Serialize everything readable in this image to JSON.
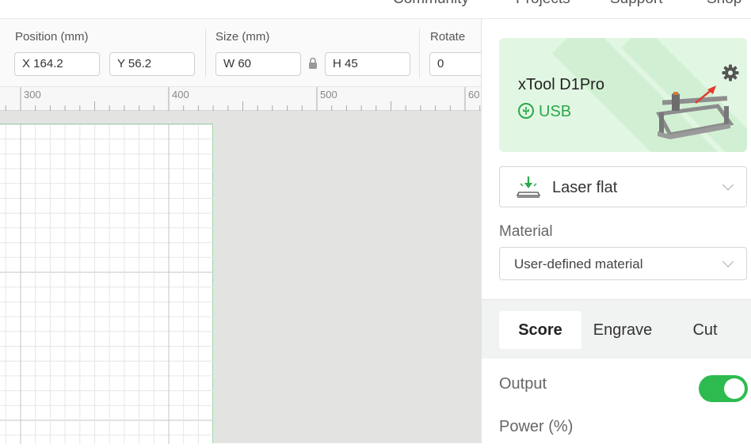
{
  "nav": {
    "links": [
      "Community",
      "Projects",
      "Support",
      "Shop"
    ]
  },
  "toolbar": {
    "position": {
      "label": "Position (mm)",
      "x": "X 164.2",
      "y": "Y 56.2"
    },
    "size": {
      "label": "Size (mm)",
      "w": "W 60",
      "h": "H 45"
    },
    "rotate": {
      "label": "Rotate",
      "value": "0"
    }
  },
  "ruler": {
    "labels": [
      "300",
      "400",
      "500",
      "60"
    ]
  },
  "device": {
    "name": "xTool D1Pro",
    "connection": "USB",
    "accent_color": "#2aa84a"
  },
  "mode": {
    "value": "Laser flat",
    "icon": "laser-flat-icon"
  },
  "material": {
    "label": "Material",
    "value": "User-defined material"
  },
  "process_tabs": [
    "Score",
    "Engrave",
    "Cut"
  ],
  "active_tab": "Score",
  "output": {
    "label": "Output",
    "enabled": true,
    "toggle_color": "#2dbb50"
  },
  "power": {
    "label": "Power (%)"
  }
}
